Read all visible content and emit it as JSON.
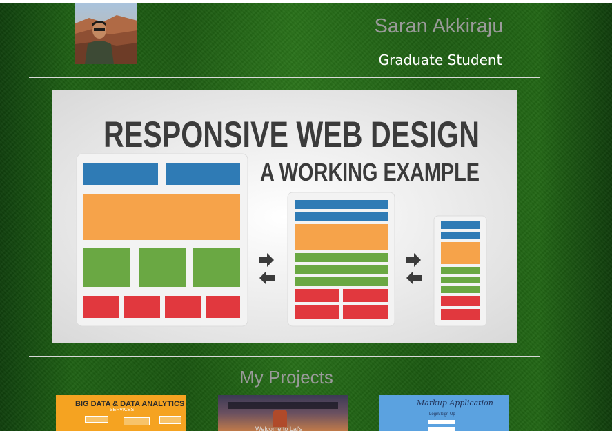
{
  "header": {
    "name": "Saran Akkiraju",
    "subtitle": "Graduate Student"
  },
  "hero": {
    "title_line1": "RESPONSIVE WEB DESIGN",
    "title_line2": "A WORKING EXAMPLE"
  },
  "projects": {
    "title": "My Projects",
    "items": [
      {
        "heading": "BIG DATA & DATA ANALYTICS",
        "subheading": "SERVICES"
      },
      {
        "heading": "Welcome to Lal's"
      },
      {
        "heading": "Markup Application",
        "subheading": "Login/Sign Up"
      }
    ]
  },
  "colors": {
    "blue": "#2f7bb5",
    "orange": "#f6a34a",
    "green": "#6aa843",
    "red": "#e1383e"
  }
}
